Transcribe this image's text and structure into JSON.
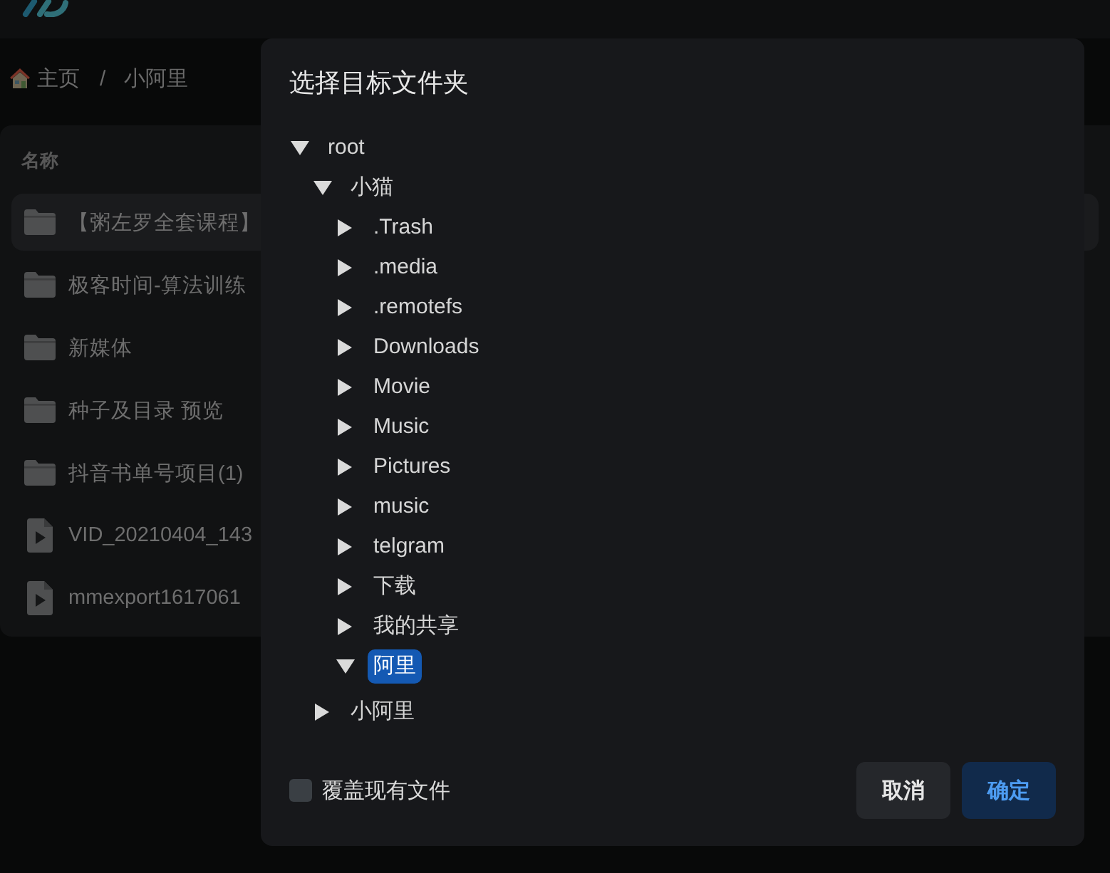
{
  "breadcrumb": {
    "items": [
      {
        "label": "主页",
        "kind": "home"
      },
      {
        "label": "小阿里",
        "kind": "folder"
      }
    ],
    "separator": "/"
  },
  "file_list": {
    "column_header": "名称",
    "rows": [
      {
        "name": "【粥左罗全套课程】",
        "kind": "folder",
        "selected": true
      },
      {
        "name": "极客时间-算法训练",
        "kind": "folder",
        "selected": false
      },
      {
        "name": "新媒体",
        "kind": "folder",
        "selected": false
      },
      {
        "name": "种子及目录 预览",
        "kind": "folder",
        "selected": false
      },
      {
        "name": "抖音书单号项目(1)",
        "kind": "folder",
        "selected": false
      },
      {
        "name": "VID_20210404_143",
        "kind": "video",
        "selected": false
      },
      {
        "name": "mmexport1617061",
        "kind": "video",
        "selected": false
      }
    ]
  },
  "dialog": {
    "title": "选择目标文件夹",
    "tree": [
      {
        "label": "root",
        "expanded": true,
        "selected": false,
        "children": [
          {
            "label": "小猫",
            "expanded": true,
            "selected": false,
            "children": [
              {
                "label": ".Trash",
                "expanded": false,
                "selected": false
              },
              {
                "label": ".media",
                "expanded": false,
                "selected": false
              },
              {
                "label": ".remotefs",
                "expanded": false,
                "selected": false
              },
              {
                "label": "Downloads",
                "expanded": false,
                "selected": false
              },
              {
                "label": "Movie",
                "expanded": false,
                "selected": false
              },
              {
                "label": "Music",
                "expanded": false,
                "selected": false
              },
              {
                "label": "Pictures",
                "expanded": false,
                "selected": false
              },
              {
                "label": "music",
                "expanded": false,
                "selected": false
              },
              {
                "label": "telgram",
                "expanded": false,
                "selected": false
              },
              {
                "label": "下载",
                "expanded": false,
                "selected": false
              },
              {
                "label": "我的共享",
                "expanded": false,
                "selected": false
              },
              {
                "label": "阿里",
                "expanded": true,
                "selected": true
              }
            ]
          },
          {
            "label": "小阿里",
            "expanded": false,
            "selected": false
          }
        ]
      }
    ],
    "overwrite": {
      "label": "覆盖现有文件",
      "checked": false
    },
    "buttons": [
      {
        "label": "取消",
        "kind": "secondary"
      },
      {
        "label": "确定",
        "kind": "primary"
      }
    ]
  }
}
